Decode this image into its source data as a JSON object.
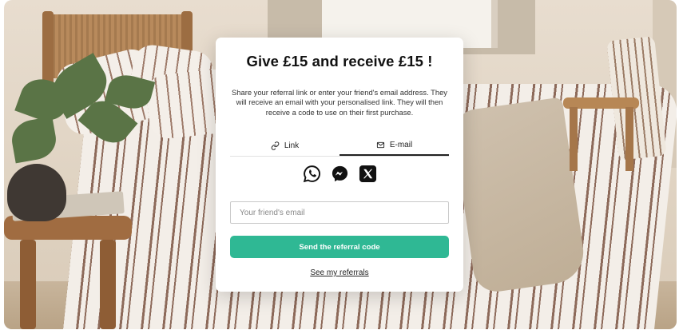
{
  "modal": {
    "title": "Give £15 and receive £15 !",
    "description": "Share your referral link or enter your friend's email address. They will receive an email with your personalised link. They will then receive a code to use on their first purchase.",
    "tabs": [
      {
        "label": "Link",
        "icon": "link-icon",
        "active": false
      },
      {
        "label": "E-mail",
        "icon": "envelope-icon",
        "active": true
      }
    ],
    "share_icons": [
      "whatsapp-icon",
      "messenger-icon",
      "x-icon"
    ],
    "email_placeholder": "Your friend's email",
    "email_value": "",
    "send_label": "Send the referral code",
    "referrals_label": "See my referrals"
  },
  "colors": {
    "accent": "#2fb894",
    "overlay_bg": "#ffffff",
    "text": "#111111"
  }
}
